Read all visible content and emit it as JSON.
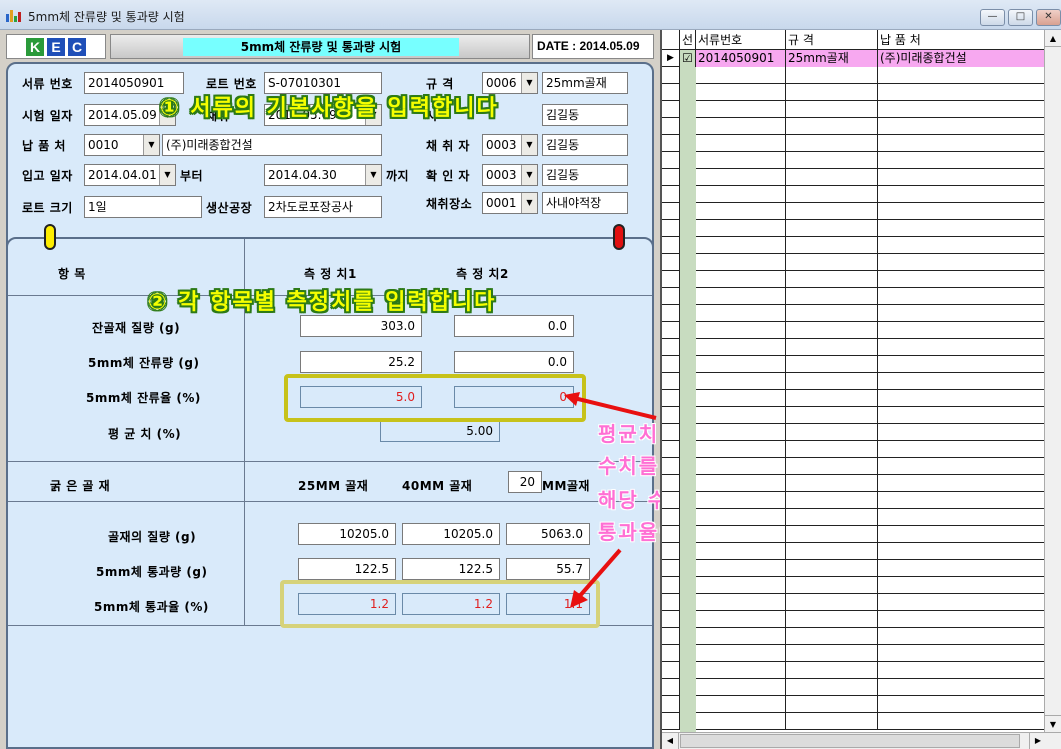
{
  "window": {
    "title": "5mm체 잔류량 및 통과량 시험",
    "controls": {
      "minimize": "—",
      "maximize": "□",
      "close": "✕"
    }
  },
  "header": {
    "logo": [
      "K",
      "E",
      "C"
    ],
    "logo_colors": [
      "#2a9a3a",
      "#1f4fb8",
      "#1f4fb8"
    ],
    "title": "5mm체 잔류량 및 통과량 시험",
    "date": "DATE : 2014.05.09"
  },
  "form": {
    "doc_no_label": "서류 번호",
    "doc_no": "2014050901",
    "lot_no_label": "로트 번호",
    "lot_no": "S-07010301",
    "spec_label": "규   격",
    "spec_code": "0006",
    "spec_name": "25mm골재",
    "test_date_label": "시험 일자",
    "test_date": "2014.05.09",
    "sample_date_label": "채취",
    "sample_date": "2014.05.09",
    "test_person_label": "시",
    "test_person_name": "김길동",
    "supplier_label": "납 품 처",
    "supplier_code": "0010",
    "supplier_name": "(주)미래종합건설",
    "sampler_label": "채 취 자",
    "sampler_code": "0003",
    "sampler_name": "김길동",
    "in_date_label": "입고 일자",
    "in_date_from": "2014.04.01",
    "from_label": "부터",
    "in_date_to": "2014.04.30",
    "to_label": "까지",
    "checker_label": "확 인 자",
    "checker_code": "0003",
    "checker_name": "김길동",
    "lot_size_label": "로트 크기",
    "lot_size": "1일",
    "factory_label": "생산공장",
    "factory": "2차도로포장공사",
    "place_label": "채취장소",
    "place_code": "0001",
    "place_name": "사내야적장"
  },
  "measure": {
    "col_item": "항          목",
    "col_m1": "측 정 치1",
    "col_m2": "측 정 치2",
    "rows": [
      {
        "label": "잔골재 질량   (g)",
        "v1": "303.0",
        "v2": "0.0"
      },
      {
        "label": "5mm체  잔류량   (g)",
        "v1": "25.2",
        "v2": "0.0"
      },
      {
        "label": "5mm체  잔류율   (%)",
        "v1": "5.0",
        "v2": "0"
      }
    ],
    "avg_label": "평   균   치   (%)",
    "avg_value": "5.00",
    "coarse_label": "굵   은   골   재",
    "coarse_25": "25MM 골재",
    "coarse_40": "40MM 골재",
    "coarse_custom_size": "20",
    "coarse_custom_suffix": "MM골재",
    "coarse_rows": [
      {
        "label": "골재의 질량   (g)",
        "v1": "10205.0",
        "v2": "10205.0",
        "v3": "5063.0"
      },
      {
        "label": "5mm체 통과량   (g)",
        "v1": "122.5",
        "v2": "122.5",
        "v3": "55.7"
      },
      {
        "label": "5mm체 통과율   (%)",
        "v1": "1.2",
        "v2": "1.2",
        "v3": "1.1"
      }
    ]
  },
  "annotations": {
    "step1": "① 서류의 기본사항을 입력합니다",
    "step2": "② 각 항목별 측정치를 입력합니다",
    "note_lines": [
      "평균치 및 통과율 (붉은 글씨) 에",
      "수치를 입력 하실 경우",
      "해당 수치에 맞게 잔류율 또는",
      "통과율이 역산됩니다"
    ]
  },
  "grid": {
    "headers": [
      "선",
      "서류번호",
      "규 격",
      "납 품 처"
    ],
    "rows": [
      {
        "marker": "▶",
        "selected": "☑",
        "doc_no": "2014050901",
        "spec": "25mm골재",
        "supplier": "(주)미래종합건설"
      }
    ],
    "highlight_color": "#f7a8f0"
  }
}
